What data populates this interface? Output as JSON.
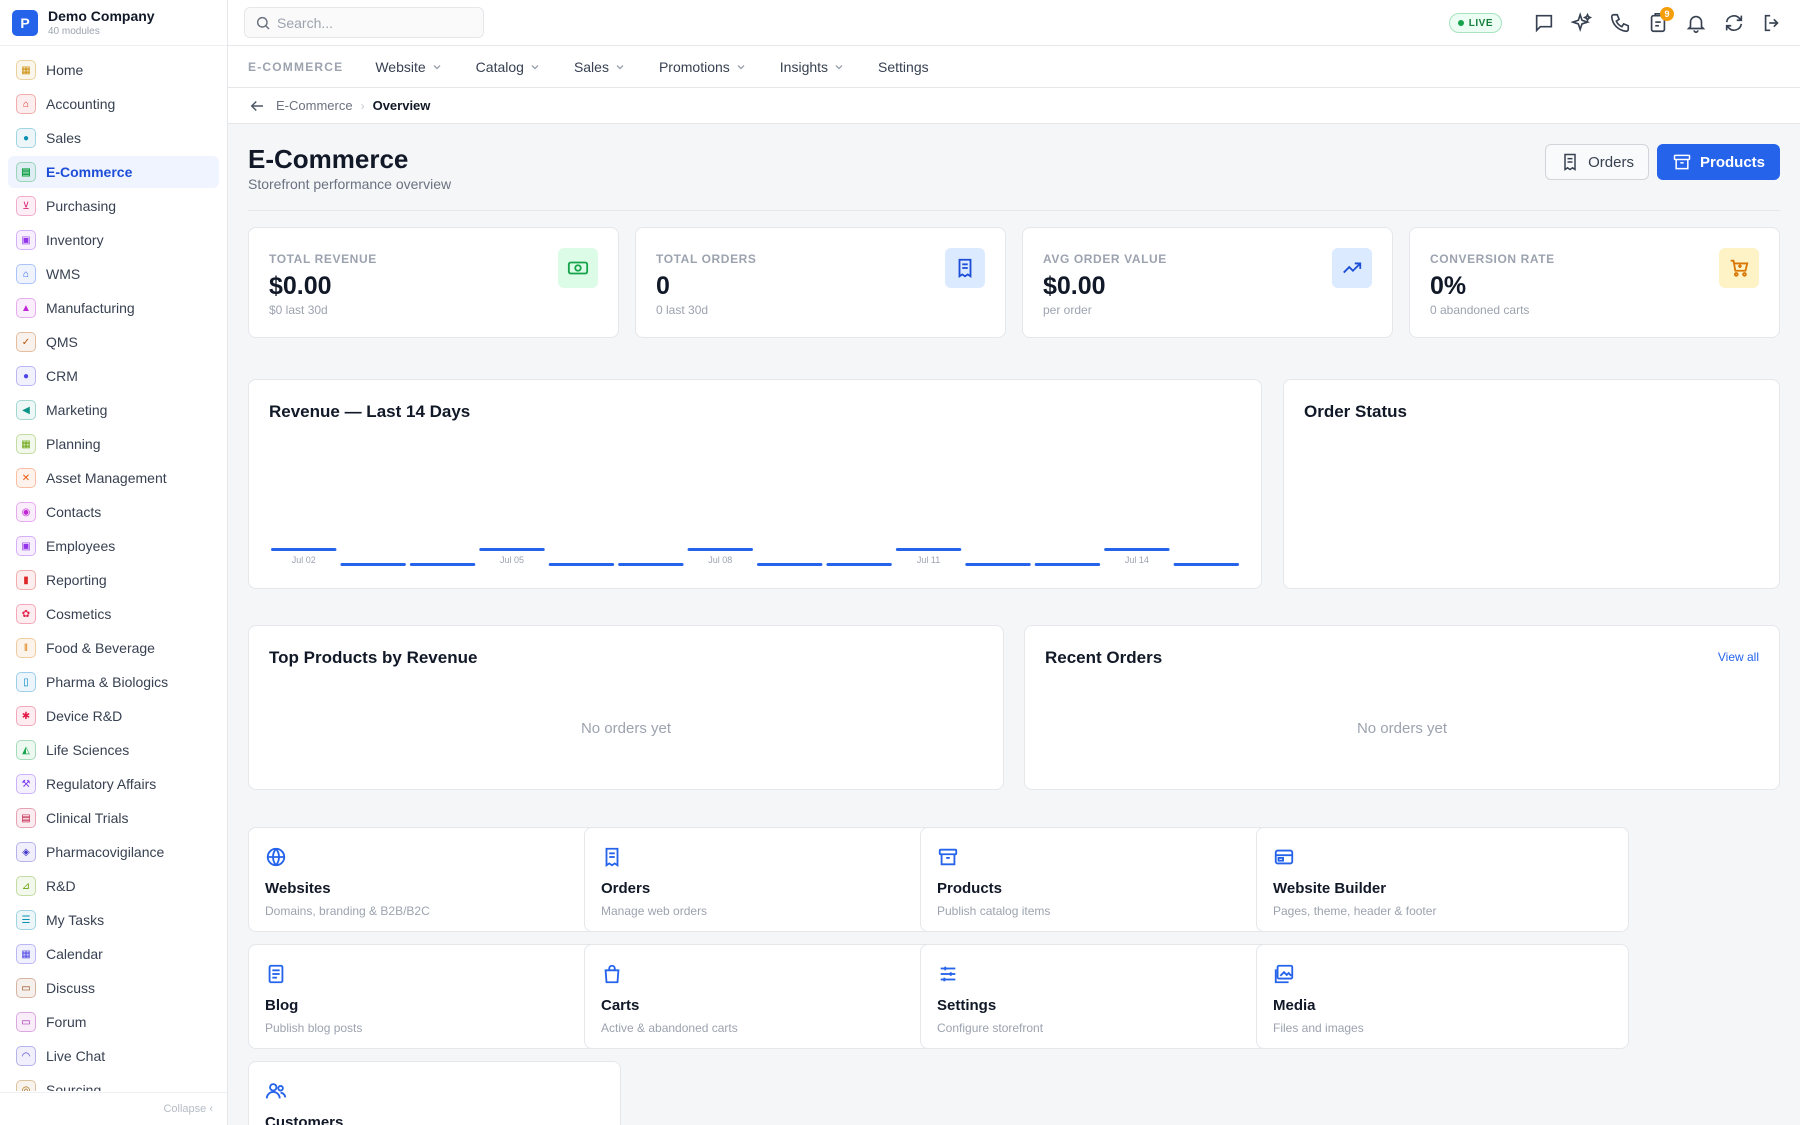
{
  "company": {
    "name": "Demo Company",
    "sub": "40 modules",
    "logo_letter": "P"
  },
  "search": {
    "placeholder": "Search..."
  },
  "status": {
    "live_label": "LIVE",
    "notification_count": "9"
  },
  "sidebar": {
    "collapse_label": "Collapse",
    "items": [
      {
        "label": "Home",
        "icon": "grid-icon",
        "color": "#ca8a04",
        "active": false
      },
      {
        "label": "Accounting",
        "icon": "bank-icon",
        "color": "#dc2626",
        "active": false
      },
      {
        "label": "Sales",
        "icon": "person-icon",
        "color": "#0891b2",
        "active": false
      },
      {
        "label": "E-Commerce",
        "icon": "store-icon",
        "color": "#16a34a",
        "active": true
      },
      {
        "label": "Purchasing",
        "icon": "cart-icon",
        "color": "#db2777",
        "active": false
      },
      {
        "label": "Inventory",
        "icon": "box-icon",
        "color": "#9333ea",
        "active": false
      },
      {
        "label": "WMS",
        "icon": "warehouse-icon",
        "color": "#2563eb",
        "active": false
      },
      {
        "label": "Manufacturing",
        "icon": "factory-icon",
        "color": "#c026d3",
        "active": false
      },
      {
        "label": "QMS",
        "icon": "check-badge-icon",
        "color": "#b45309",
        "active": false
      },
      {
        "label": "CRM",
        "icon": "users-icon",
        "color": "#4f46e5",
        "active": false
      },
      {
        "label": "Marketing",
        "icon": "megaphone-icon",
        "color": "#0d9488",
        "active": false
      },
      {
        "label": "Planning",
        "icon": "calendar-icon",
        "color": "#65a30d",
        "active": false
      },
      {
        "label": "Asset Management",
        "icon": "tools-icon",
        "color": "#ea580c",
        "active": false
      },
      {
        "label": "Contacts",
        "icon": "contact-icon",
        "color": "#c026d3",
        "active": false
      },
      {
        "label": "Employees",
        "icon": "badge-icon",
        "color": "#9333ea",
        "active": false
      },
      {
        "label": "Reporting",
        "icon": "bar-chart-icon",
        "color": "#dc2626",
        "active": false
      },
      {
        "label": "Cosmetics",
        "icon": "flower-icon",
        "color": "#e11d48",
        "active": false
      },
      {
        "label": "Food & Beverage",
        "icon": "utensils-icon",
        "color": "#d97706",
        "active": false
      },
      {
        "label": "Pharma & Biologics",
        "icon": "pill-icon",
        "color": "#0284c7",
        "active": false
      },
      {
        "label": "Device R&D",
        "icon": "chip-icon",
        "color": "#e11d48",
        "active": false
      },
      {
        "label": "Life Sciences",
        "icon": "microscope-icon",
        "color": "#16a34a",
        "active": false
      },
      {
        "label": "Regulatory Affairs",
        "icon": "gavel-icon",
        "color": "#7c3aed",
        "active": false
      },
      {
        "label": "Clinical Trials",
        "icon": "clipboard-icon",
        "color": "#be123c",
        "active": false
      },
      {
        "label": "Pharmacovigilance",
        "icon": "shield-icon",
        "color": "#4338ca",
        "active": false
      },
      {
        "label": "R&D",
        "icon": "flask-icon",
        "color": "#65a30d",
        "active": false
      },
      {
        "label": "My Tasks",
        "icon": "checklist-icon",
        "color": "#0891b2",
        "active": false
      },
      {
        "label": "Calendar",
        "icon": "calendar-icon",
        "color": "#4f46e5",
        "active": false
      },
      {
        "label": "Discuss",
        "icon": "chat-icon",
        "color": "#92400e",
        "active": false
      },
      {
        "label": "Forum",
        "icon": "forum-icon",
        "color": "#a21caf",
        "active": false
      },
      {
        "label": "Live Chat",
        "icon": "headset-icon",
        "color": "#4338ca",
        "active": false
      },
      {
        "label": "Sourcing",
        "icon": "sourcing-icon",
        "color": "#a16207",
        "active": false
      }
    ]
  },
  "subnav": {
    "title": "E-COMMERCE",
    "items": [
      {
        "label": "Website",
        "has_menu": true
      },
      {
        "label": "Catalog",
        "has_menu": true
      },
      {
        "label": "Sales",
        "has_menu": true
      },
      {
        "label": "Promotions",
        "has_menu": true
      },
      {
        "label": "Insights",
        "has_menu": true
      },
      {
        "label": "Settings",
        "has_menu": false
      }
    ]
  },
  "breadcrumb": {
    "parent": "E-Commerce",
    "current": "Overview"
  },
  "page": {
    "title": "E-Commerce",
    "subtitle": "Storefront performance overview",
    "orders_button": "Orders",
    "products_button": "Products"
  },
  "stats": [
    {
      "label": "TOTAL REVENUE",
      "value": "$0.00",
      "sub": "$0 last 30d",
      "icon": "cash-icon",
      "color": "#16a34a",
      "bg": "#dcfce7"
    },
    {
      "label": "TOTAL ORDERS",
      "value": "0",
      "sub": "0 last 30d",
      "icon": "receipt-icon",
      "color": "#1d4ed8",
      "bg": "#dbeafe"
    },
    {
      "label": "AVG ORDER VALUE",
      "value": "$0.00",
      "sub": "per order",
      "icon": "trend-up-icon",
      "color": "#1d4ed8",
      "bg": "#dbeafe"
    },
    {
      "label": "CONVERSION RATE",
      "value": "0%",
      "sub": "0 abandoned carts",
      "icon": "cart-icon",
      "color": "#d97706",
      "bg": "#fef3c7"
    }
  ],
  "revenue_card": {
    "title": "Revenue — Last 14 Days"
  },
  "order_status_card": {
    "title": "Order Status"
  },
  "top_products": {
    "title": "Top Products by Revenue",
    "empty": "No orders yet"
  },
  "recent_orders": {
    "title": "Recent Orders",
    "view_all": "View all",
    "empty": "No orders yet"
  },
  "tiles": [
    {
      "title": "Websites",
      "sub": "Domains, branding & B2B/B2C",
      "icon": "globe-icon"
    },
    {
      "title": "Orders",
      "sub": "Manage web orders",
      "icon": "receipt-icon"
    },
    {
      "title": "Products",
      "sub": "Publish catalog items",
      "icon": "archive-icon"
    },
    {
      "title": "Website Builder",
      "sub": "Pages, theme, header & footer",
      "icon": "layout-icon"
    },
    {
      "title": "Blog",
      "sub": "Publish blog posts",
      "icon": "document-icon"
    },
    {
      "title": "Carts",
      "sub": "Active & abandoned carts",
      "icon": "bag-icon"
    },
    {
      "title": "Settings",
      "sub": "Configure storefront",
      "icon": "sliders-icon"
    },
    {
      "title": "Media",
      "sub": "Files and images",
      "icon": "images-icon"
    },
    {
      "title": "Customers",
      "sub": "",
      "icon": "customers-icon"
    }
  ],
  "chart_data": {
    "type": "bar",
    "title": "Revenue — Last 14 Days",
    "categories": [
      "Jul 02",
      "Jul 03",
      "Jul 04",
      "Jul 05",
      "Jul 06",
      "Jul 07",
      "Jul 08",
      "Jul 09",
      "Jul 10",
      "Jul 11",
      "Jul 12",
      "Jul 13",
      "Jul 14",
      "Jul 15"
    ],
    "tick_labels": [
      "Jul 02",
      "Jul 05",
      "Jul 08",
      "Jul 11",
      "Jul 14"
    ],
    "values": [
      0,
      0,
      0,
      0,
      0,
      0,
      0,
      0,
      0,
      0,
      0,
      0,
      0,
      0
    ],
    "color": "#2563eb"
  }
}
